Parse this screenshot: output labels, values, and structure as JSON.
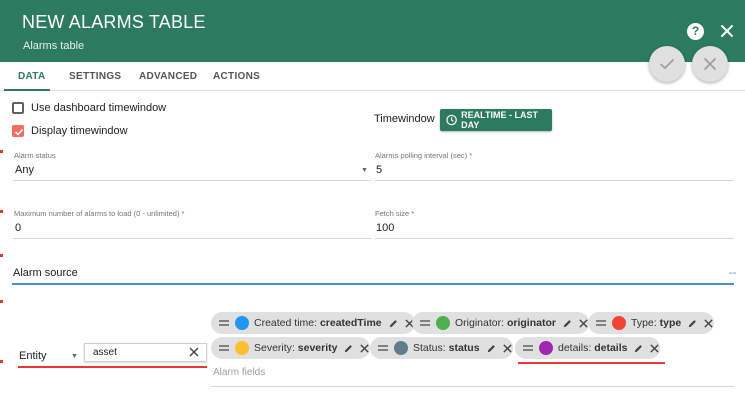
{
  "header": {
    "title": "NEW ALARMS TABLE",
    "subtitle": "Alarms table",
    "help_symbol": "?",
    "bg_color": "#2c7a60"
  },
  "tabs": [
    {
      "label": "DATA",
      "active": true
    },
    {
      "label": "SETTINGS",
      "active": false
    },
    {
      "label": "ADVANCED",
      "active": false
    },
    {
      "label": "ACTIONS",
      "active": false
    }
  ],
  "checkboxes": {
    "use_dashboard_timewindow": {
      "label": "Use dashboard timewindow",
      "checked": false
    },
    "display_timewindow": {
      "label": "Display timewindow",
      "checked": true
    }
  },
  "timewindow": {
    "label": "Timewindow",
    "button_label": "REALTIME - LAST DAY",
    "icon": "clock-icon"
  },
  "fields": {
    "alarm_status": {
      "label": "Alarm status",
      "value": "Any"
    },
    "polling_interval": {
      "label": "Alarms polling interval (sec) *",
      "value": "5"
    },
    "max_alarms": {
      "label": "Maximum number of alarms to load (0 - unlimited) *",
      "value": "0"
    },
    "fetch_size": {
      "label": "Fetch size *",
      "value": "100"
    }
  },
  "alarm_source": {
    "label": "Alarm source",
    "dash": "--",
    "entity_type": "Entity",
    "entity_value": "asset"
  },
  "chips": [
    {
      "name": "Created time",
      "key": "createdTime",
      "color": "#2196f3"
    },
    {
      "name": "Originator",
      "key": "originator",
      "color": "#4caf50"
    },
    {
      "name": "Type",
      "key": "type",
      "color": "#f44336"
    },
    {
      "name": "Severity",
      "key": "severity",
      "color": "#fbc02d"
    },
    {
      "name": "Status",
      "key": "status",
      "color": "#607d8b"
    },
    {
      "name": "details",
      "key": "details",
      "color": "#9c27b0"
    }
  ],
  "alarm_fields_placeholder": "Alarm fields",
  "accent_colors": {
    "primary": "#2c7a60",
    "checkbox": "#f46d5e",
    "focus": "#4c8dd6",
    "error": "#e53935"
  }
}
